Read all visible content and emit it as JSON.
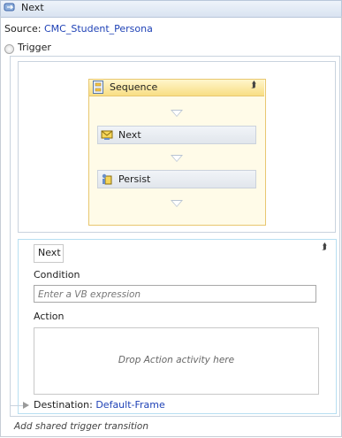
{
  "title": "Next",
  "source": {
    "label": "Source:",
    "value": "CMC_Student_Persona"
  },
  "trigger": {
    "label": "Trigger"
  },
  "sequence": {
    "title": "Sequence",
    "activities": [
      {
        "label": "Next",
        "icon": "receive-message-icon"
      },
      {
        "label": "Persist",
        "icon": "persist-icon"
      }
    ]
  },
  "transition": {
    "name": "Next",
    "condition_label": "Condition",
    "condition_placeholder": "Enter a VB expression",
    "action_label": "Action",
    "action_hint": "Drop Action activity here",
    "destination_label": "Destination:",
    "destination_value": "Default-Frame"
  },
  "add_shared": "Add shared trigger transition",
  "colors": {
    "link": "#1f42b6",
    "sequence_header": "#f8de84",
    "sequence_border": "#e8c770"
  }
}
